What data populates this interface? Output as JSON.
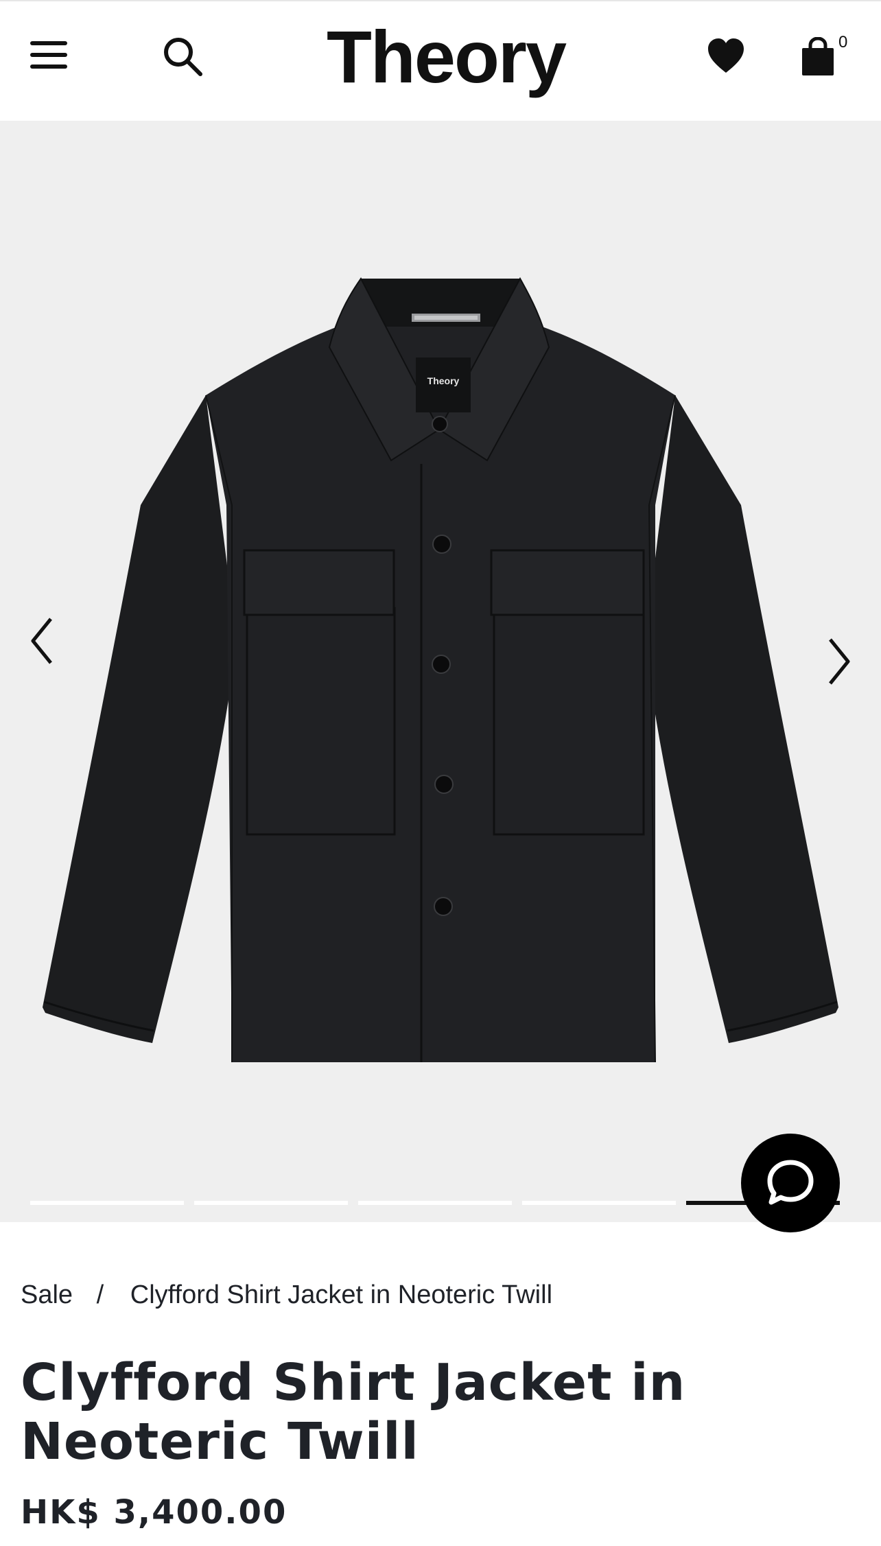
{
  "header": {
    "logo_text": "Theory",
    "bag_count": "0",
    "icons": [
      "menu-icon",
      "search-icon",
      "heart-icon",
      "shopping-bag-icon"
    ]
  },
  "gallery": {
    "slide_count": 5,
    "active_slide": 5,
    "icons": [
      "chevron-left-icon",
      "chevron-right-icon",
      "chat-bubble-icon"
    ],
    "garment_label_text": "Theory"
  },
  "breadcrumb": {
    "parent": "Sale",
    "separator": "/",
    "current": "Clyfford Shirt Jacket in Neoteric Twill"
  },
  "product": {
    "title": "Clyfford Shirt Jacket in Neoteric Twill",
    "price": "HK$ 3,400.00"
  },
  "colors": {
    "text": "#1f2228",
    "gallery_bg": "#efefef",
    "garment": "#1c1d1f",
    "chat_button": "#000000"
  }
}
